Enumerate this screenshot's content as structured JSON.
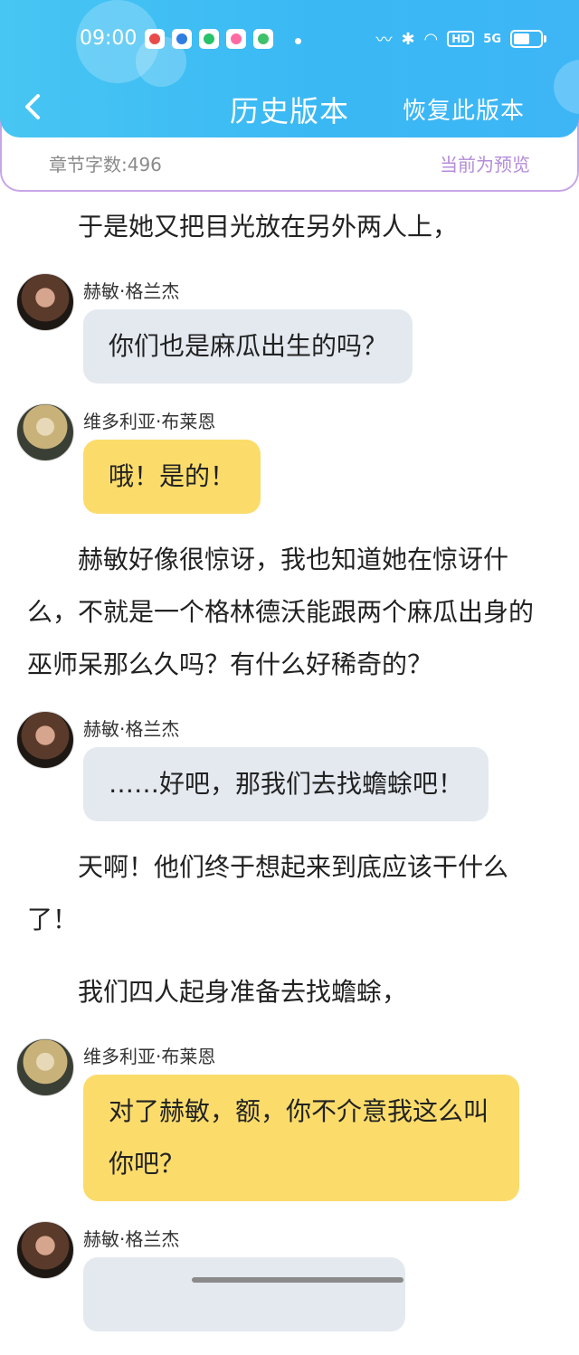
{
  "status_bar": {
    "time": "09:00",
    "hd_label": "HD",
    "signal_label": "5G",
    "battery_level": 0.6
  },
  "nav": {
    "title": "历史版本",
    "restore_label": "恢复此版本"
  },
  "info": {
    "word_count": "章节字数:496",
    "preview_label": "当前为预览"
  },
  "blocks": {
    "p1": "于是她又把目光放在另外两人上，",
    "m1": {
      "sender": "赫敏·格兰杰",
      "text": "你们也是麻瓜出生的吗？"
    },
    "m2": {
      "sender": "维多利亚·布莱恩",
      "text": "哦！是的！"
    },
    "p2": "赫敏好像很惊讶，我也知道她在惊讶什么，不就是一个格林德沃能跟两个麻瓜出身的巫师呆那么久吗？有什么好稀奇的？",
    "m3": {
      "sender": "赫敏·格兰杰",
      "text": "……好吧，那我们去找蟾蜍吧！"
    },
    "p3": "天啊！他们终于想起来到底应该干什么了！",
    "p4": "我们四人起身准备去找蟾蜍，",
    "m4": {
      "sender": "维多利亚·布莱恩",
      "text": "对了赫敏，额，你不介意我这么叫你吧？"
    },
    "m5": {
      "sender": "赫敏·格兰杰"
    }
  },
  "colors": {
    "header": "#3ab8f4",
    "bubble_gray": "#e4e9f0",
    "bubble_yellow": "#fbdc6b",
    "preview_purple": "#b48cd9"
  }
}
